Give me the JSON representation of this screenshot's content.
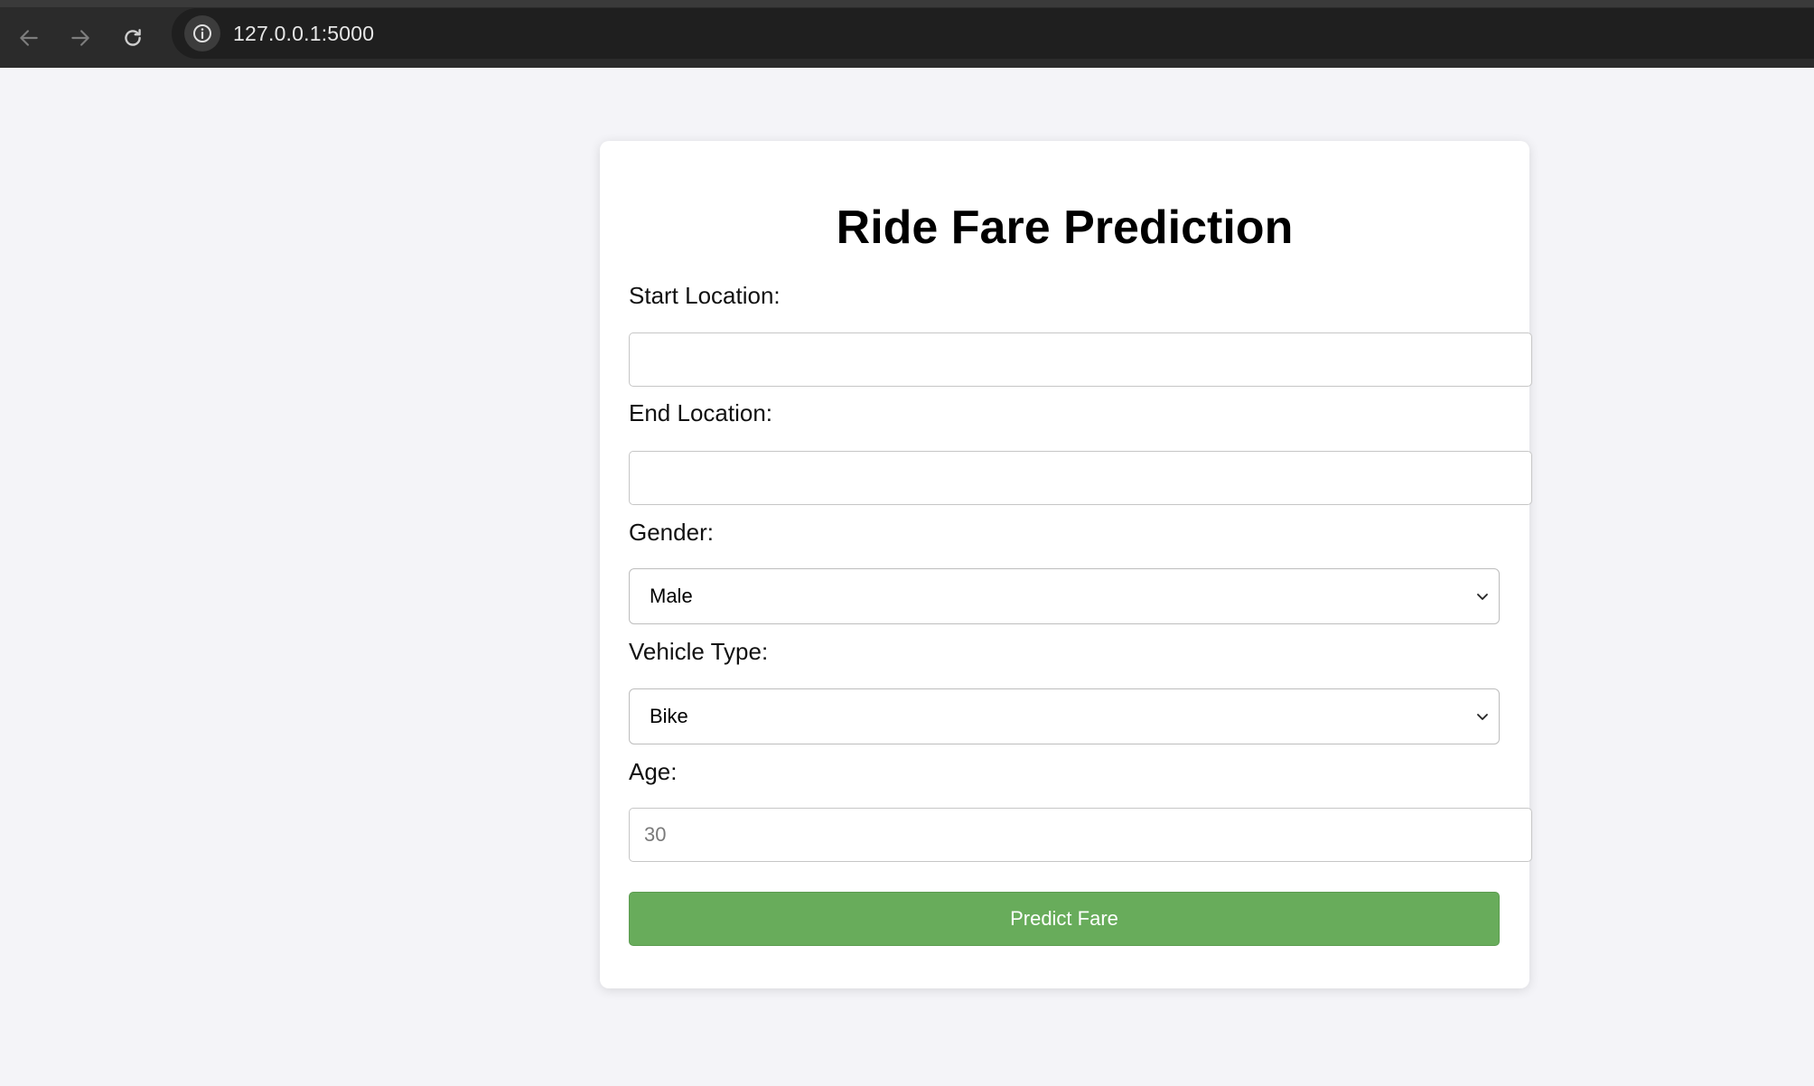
{
  "browser": {
    "url": "127.0.0.1:5000"
  },
  "form": {
    "title": "Ride Fare Prediction",
    "start_location": {
      "label": "Start Location:",
      "value": ""
    },
    "end_location": {
      "label": "End Location:",
      "value": ""
    },
    "gender": {
      "label": "Gender:",
      "selected": "Male"
    },
    "vehicle_type": {
      "label": "Vehicle Type:",
      "selected": "Bike"
    },
    "age": {
      "label": "Age:",
      "placeholder": "30"
    },
    "submit_label": "Predict Fare"
  },
  "colors": {
    "button_green": "#68ac5b",
    "page_background": "#f4f4f8",
    "browser_toolbar": "#2b2b2b"
  }
}
